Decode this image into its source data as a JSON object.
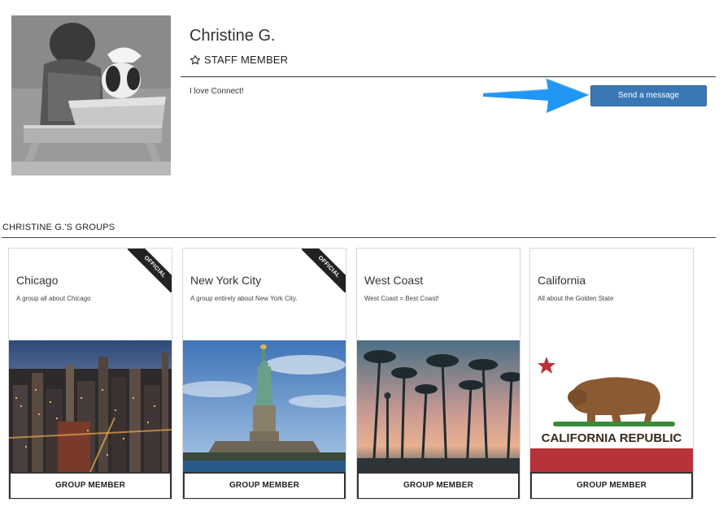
{
  "profile": {
    "name": "Christine G.",
    "role": "STAFF MEMBER",
    "bio": "I love Connect!",
    "send_message_label": "Send a message"
  },
  "groups": {
    "heading": "CHRISTINE G.'S GROUPS",
    "items": [
      {
        "title": "Chicago",
        "description": "A group all about Chicago",
        "badge": "OFFICIAL",
        "membership": "GROUP MEMBER",
        "image": "chicago-skyline"
      },
      {
        "title": "New York City",
        "description": "A group entirely about New York City.",
        "badge": "OFFICIAL",
        "membership": "GROUP MEMBER",
        "image": "statue-of-liberty"
      },
      {
        "title": "West Coast",
        "description": "West Coast = Best Coast!",
        "membership": "GROUP MEMBER",
        "image": "palm-trees-sunset"
      },
      {
        "title": "California",
        "description": "All about the Golden State",
        "membership": "GROUP MEMBER",
        "image": "california-flag",
        "image_text": "CALIFORNIA REPUBLIC"
      }
    ]
  },
  "colors": {
    "button_blue": "#3a78b5",
    "arrow_blue": "#2196f3",
    "flag_red": "#b8323a",
    "ribbon": "#222222"
  }
}
